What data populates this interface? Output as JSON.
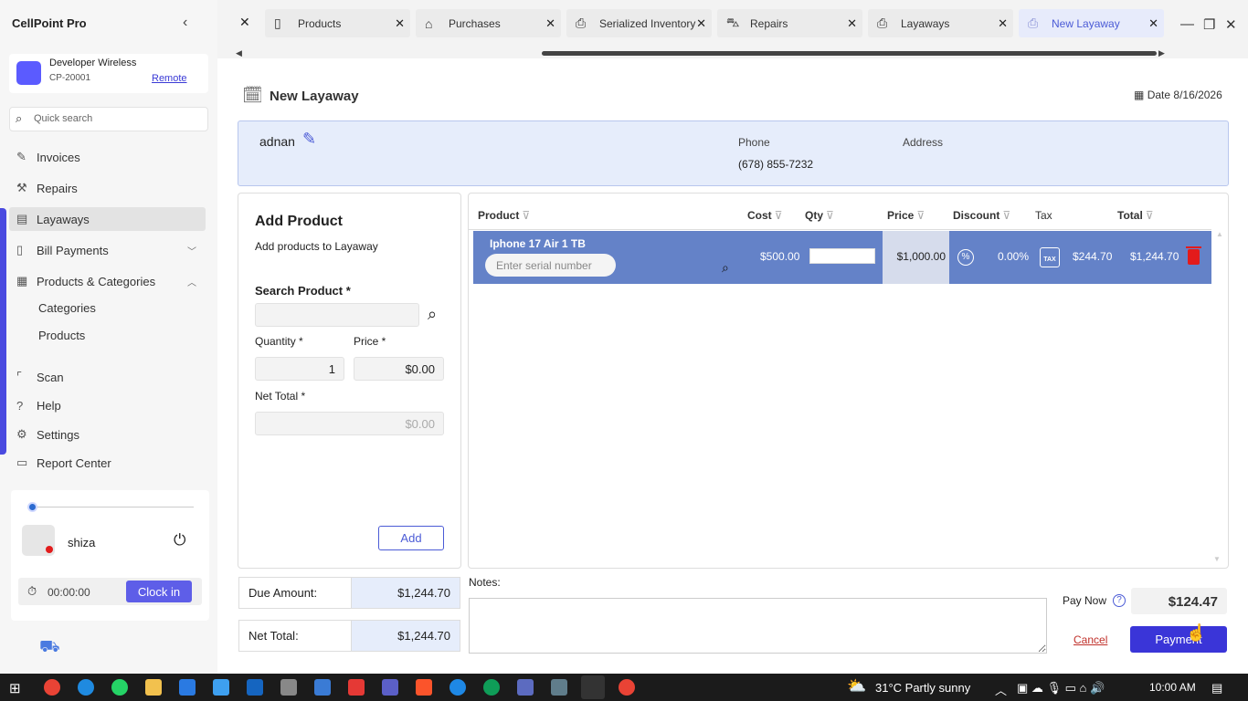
{
  "app": {
    "title": "CellPoint Pro",
    "collapse_icon": "chevron-left-icon"
  },
  "store": {
    "name": "Developer Wireless",
    "code": "CP-20001",
    "mode": "Remote",
    "logo_color": "#5b5bff"
  },
  "search": {
    "placeholder": "Quick search"
  },
  "nav": {
    "invoices": "Invoices",
    "repairs": "Repairs",
    "layaways": "Layaways",
    "bill_payments": "Bill Payments",
    "products_categories": "Products & Categories",
    "categories": "Categories",
    "products": "Products",
    "scan": "Scan",
    "help": "Help",
    "settings": "Settings",
    "report_center": "Report Center",
    "active": "Layaways"
  },
  "user": {
    "name": "shiza",
    "timer": "00:00:00",
    "clock_in": "Clock in",
    "status_color": "#e21c1c"
  },
  "tabs": [
    {
      "label": "Products",
      "icon": "tablet-icon"
    },
    {
      "label": "Purchases",
      "icon": "basket-icon"
    },
    {
      "label": "Serialized Inventory",
      "icon": "printer-icon"
    },
    {
      "label": "Repairs",
      "icon": "car-icon"
    },
    {
      "label": "Layaways",
      "icon": "printer-icon"
    },
    {
      "label": "New Layaway",
      "icon": "printer-icon",
      "active": true
    }
  ],
  "page": {
    "title": "New Layaway",
    "date_label": "Date",
    "date": "8/16/2026"
  },
  "customer": {
    "name": "adnan",
    "phone_label": "Phone",
    "phone": "(678) 855-7232",
    "address_label": "Address"
  },
  "add_product": {
    "title": "Add Product",
    "subtitle": "Add products to Layaway",
    "search_label": "Search Product *",
    "quantity_label": "Quantity *",
    "quantity": "1",
    "price_label": "Price *",
    "price": "$0.00",
    "net_total_label": "Net Total *",
    "net_total": "$0.00",
    "add_button": "Add"
  },
  "grid": {
    "columns": [
      "Product",
      "Cost",
      "Qty",
      "Price",
      "Discount",
      "Tax",
      "Total"
    ],
    "rows": [
      {
        "product": "Iphone 17 Air 1 TB",
        "serial_placeholder": "Enter serial number",
        "cost": "$500.00",
        "qty": "",
        "price": "$1,000.00",
        "discount": "0.00%",
        "tax": "$244.70",
        "total": "$1,244.70"
      }
    ],
    "row_color": "#6482c8"
  },
  "summary": {
    "due_label": "Due Amount:",
    "due": "$1,244.70",
    "net_label": "Net Total:",
    "net": "$1,244.70"
  },
  "notes": {
    "label": "Notes:"
  },
  "payment": {
    "pay_now_label": "Pay Now",
    "pay_now": "$124.47",
    "cancel": "Cancel",
    "payment_button": "Payment"
  },
  "taskbar": {
    "weather": "31°C  Partly sunny",
    "time": "10:00 AM"
  },
  "colors": {
    "accent": "#4b5bd6",
    "primary_button": "#3a35d8",
    "danger": "#e31b1b"
  }
}
